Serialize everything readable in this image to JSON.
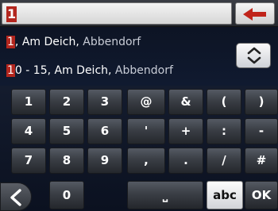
{
  "input": {
    "typed_text": "1",
    "backspace_icon": "arrow-left-icon",
    "accent_color": "#b3261e"
  },
  "results": [
    {
      "match": "1",
      "rest": ", Am Deich,",
      "town": " Abbendorf"
    },
    {
      "match": "1",
      "rest": "0 - 15, Am Deich,",
      "town": " Abbendorf"
    }
  ],
  "scroll_icon": "chevron-up-down-icon",
  "keys": {
    "row1": [
      "1",
      "2",
      "3",
      "@",
      "&",
      "(",
      ")"
    ],
    "row2": [
      "4",
      "5",
      "6",
      "'",
      "+",
      ":",
      "-"
    ],
    "row3": [
      "7",
      "8",
      "9",
      ",",
      ".",
      "/",
      "#"
    ],
    "row4": {
      "zero": "0",
      "space": "⎵",
      "mode": "abc",
      "ok": "OK"
    }
  },
  "back_icon": "chevron-left-icon"
}
